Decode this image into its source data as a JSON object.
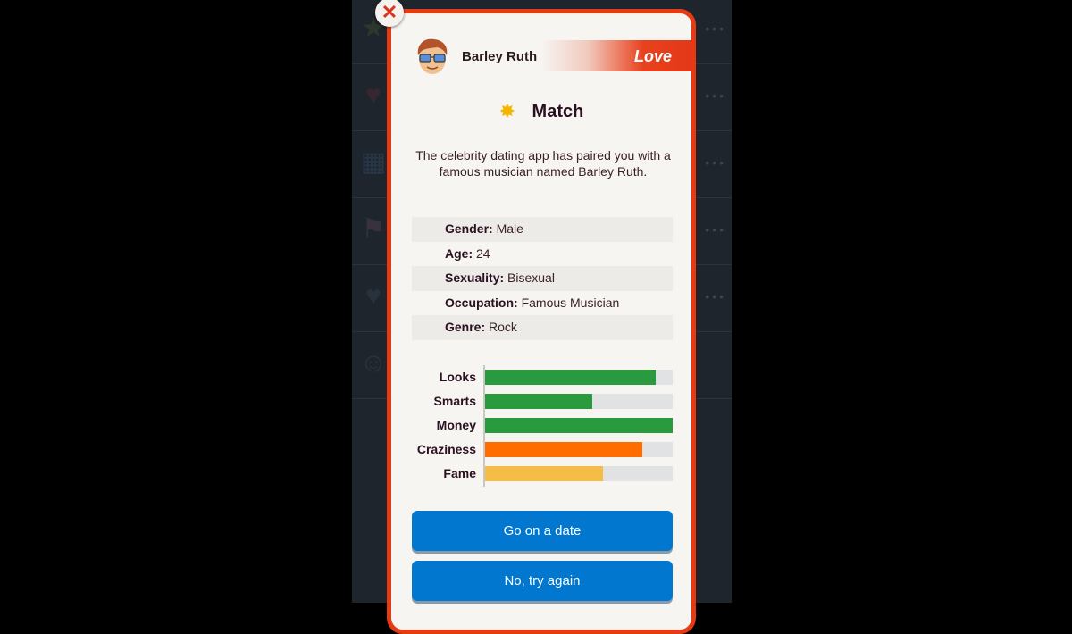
{
  "background_list": {
    "rows": [
      {
        "icon": "star-icon",
        "glyph": "★",
        "color": "#4a5a2a"
      },
      {
        "icon": "heart-icon",
        "glyph": "♥",
        "color": "#6a2a3a"
      },
      {
        "icon": "calendar-arrow-icon",
        "glyph": "▦",
        "color": "#3a5a7a"
      },
      {
        "icon": "rainbow-flag-icon",
        "glyph": "⚑",
        "color": "#6a4a5a"
      },
      {
        "icon": "heart-icon",
        "glyph": "♥",
        "color": "#3a4a5a"
      },
      {
        "icon": "devil-face-icon",
        "glyph": "☺",
        "color": "#4a4f55"
      }
    ],
    "more_glyph": "•••"
  },
  "modal": {
    "close_glyph": "✕",
    "header": {
      "name": "Barley Ruth",
      "category": "Love"
    },
    "title": {
      "icon_glyph": "✸",
      "text": "Match"
    },
    "description": "The celebrity dating app has paired you with a famous musician named Barley Ruth.",
    "info": [
      {
        "label": "Gender:",
        "value": "Male"
      },
      {
        "label": "Age:",
        "value": "24"
      },
      {
        "label": "Sexuality:",
        "value": "Bisexual"
      },
      {
        "label": "Occupation:",
        "value": "Famous Musician"
      },
      {
        "label": "Genre:",
        "value": "Rock"
      }
    ],
    "stats": [
      {
        "label": "Looks",
        "percent": 91,
        "color": "#2a9a3e"
      },
      {
        "label": "Smarts",
        "percent": 57,
        "color": "#2a9a3e"
      },
      {
        "label": "Money",
        "percent": 100,
        "color": "#2a9a3e"
      },
      {
        "label": "Craziness",
        "percent": 84,
        "color": "#ff6d00"
      },
      {
        "label": "Fame",
        "percent": 63,
        "color": "#f4bd45"
      }
    ],
    "buttons": {
      "primary": "Go on a date",
      "secondary": "No, try again"
    }
  }
}
